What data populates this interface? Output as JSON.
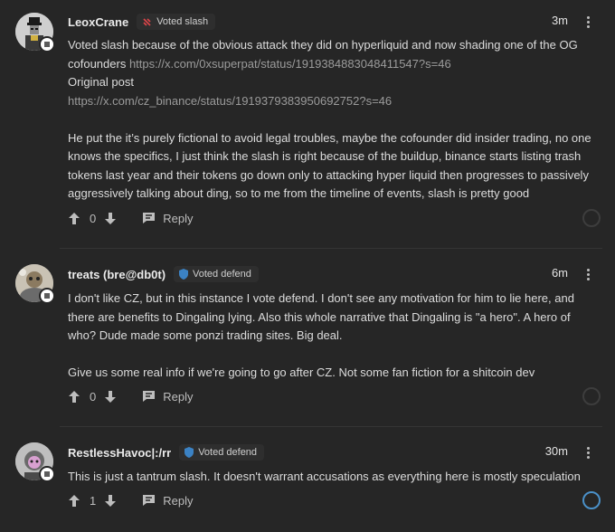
{
  "comments": [
    {
      "username": "LeoxCrane",
      "vote": "Voted slash",
      "vote_type": "slash",
      "time": "3m",
      "lines": [
        "Voted slash because of the obvious attack they did on hyperliquid and now shading one of the OG"
      ],
      "line2_text": "cofounders",
      "link1": "https://x.com/0xsuperpat/status/1919384883048411547?s=46",
      "line3": "Original post",
      "link2": "https://x.com/cz_binance/status/1919379383950692752?s=46",
      "paragraph": [
        "He put the it’s purely fictional to avoid legal troubles, maybe the cofounder did insider trading, no one",
        "knows the specifics, I just think the slash is right because of the buildup, binance starts listing trash",
        "tokens last year and their tokens go down only to attacking hyper liquid then progresses to passively",
        "aggressively talking about ding, so to me from the timeline of events, slash is pretty good"
      ],
      "score": "0",
      "reply_label": "Reply"
    },
    {
      "username": "treats (bre@db0t)",
      "vote": "Voted defend",
      "vote_type": "defend",
      "time": "6m",
      "paragraph1": [
        "I don't like CZ, but in this instance I vote defend. I don't see any motivation for him to lie here, and",
        "there are benefits to Dingaling lying. Also this whole narrative that Dingaling is \"a hero\". A hero of",
        "who? Dude made some ponzi trading sites. Big deal."
      ],
      "paragraph2": [
        "Give us some real info if we're going to go after CZ. Not some fan fiction for a shitcoin dev"
      ],
      "score": "0",
      "reply_label": "Reply"
    },
    {
      "username": "RestlessHavoc|:/rr",
      "vote": "Voted defend",
      "vote_type": "defend",
      "time": "30m",
      "paragraph1": [
        "This is just a tantrum slash. It doesn't warrant accusations as everything here is mostly speculation"
      ],
      "score": "1",
      "reply_label": "Reply"
    }
  ],
  "colors": {
    "background": "#262626",
    "slash_red": "#e0454a",
    "defend_blue": "#3b82c4",
    "link": "#9b9b9b"
  },
  "icons": [
    "vote-slash-icon",
    "shield-icon",
    "upvote-icon",
    "downvote-icon",
    "reply-icon",
    "more-icon",
    "tag-icon"
  ]
}
